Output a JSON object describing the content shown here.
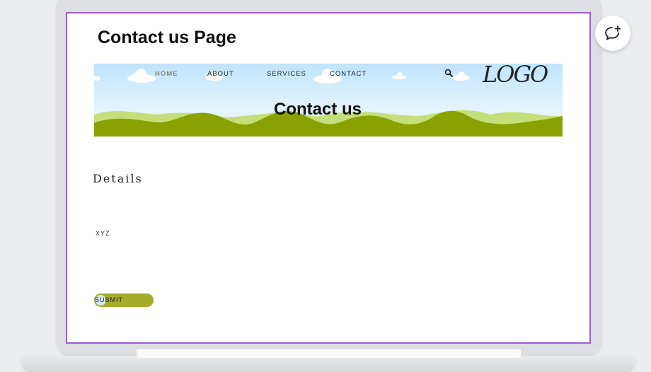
{
  "page": {
    "title": "Contact us Page"
  },
  "nav": {
    "items": [
      {
        "label": "HOME",
        "active": true
      },
      {
        "label": "ABOUT"
      },
      {
        "label": "SERVICES"
      },
      {
        "label": "CONTACT"
      }
    ],
    "search_icon": "search-icon",
    "logo_text": "LOGO"
  },
  "banner": {
    "title": "Contact us"
  },
  "content": {
    "details_heading": "Details",
    "details_text": "XYZ"
  },
  "form": {
    "submit_label": "SUBMIT"
  },
  "toolbar": {
    "comment_icon": "add-comment-icon"
  },
  "colors": {
    "frame_accent": "#9a5de0",
    "button": "#a2ad2c",
    "hills_dark": "#8aa200",
    "hills_light": "#c4df7a",
    "sky": "#bfe4fb"
  }
}
